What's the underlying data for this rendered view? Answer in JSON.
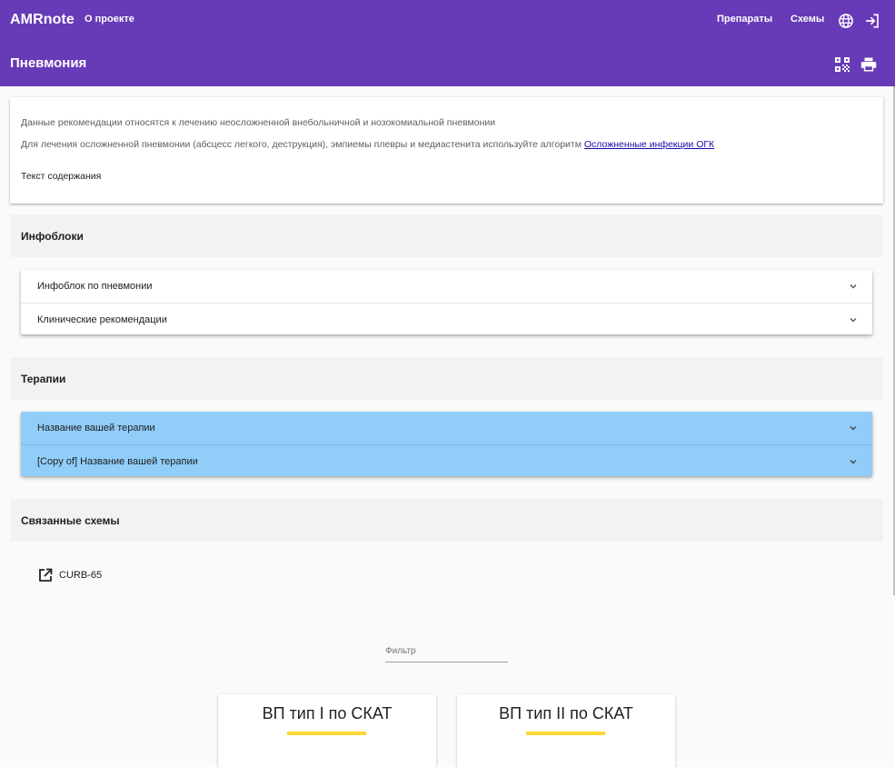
{
  "header": {
    "brand": "AMRnote",
    "about": "О проекте",
    "nav": [
      "Препараты",
      "Схемы"
    ],
    "icons": [
      "globe-icon",
      "login-icon"
    ],
    "page_title": "Пневмония",
    "page_icons": [
      "qr-code-icon",
      "print-icon"
    ],
    "color": "#673ab7"
  },
  "intro": {
    "line1": "Данные рекомендации относятся к лечению неосложненной внебольничной и нозокомиальной пневмонии",
    "line2_prefix": "Для лечения осложненной пневмонии (абсцесс легкого, деструкция), эмпиемы плевры и медиастенита используйте алгоритм ",
    "line2_link": "Осложненные инфекции ОГК",
    "line3": "Текст содержания"
  },
  "infoblocks": {
    "heading": "Инфоблоки",
    "items": [
      "Инфоблок по пневмонии",
      "Клинические рекомендации"
    ]
  },
  "therapies": {
    "heading": "Терапии",
    "items": [
      "Название вашей терапии",
      "[Copy of] Название вашей терапии"
    ],
    "color": "#90cdf9"
  },
  "schemes": {
    "heading": "Связанные схемы",
    "links": [
      "CURB-65"
    ]
  },
  "filter": {
    "placeholder": "Фильтр",
    "value": ""
  },
  "tiles": [
    {
      "title": "ВП тип I по СКАТ"
    },
    {
      "title": "ВП тип II по СКАТ"
    }
  ],
  "accent": "#fdd835"
}
